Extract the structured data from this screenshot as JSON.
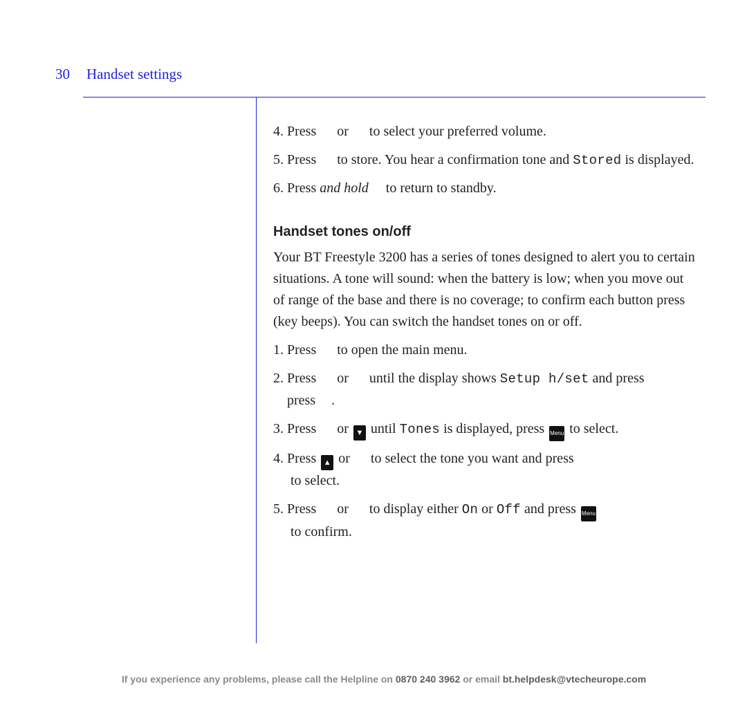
{
  "header": {
    "page_number": "30",
    "section": "Handset settings"
  },
  "steps_top": {
    "s4_a": "4. Press ",
    "s4_or": " or ",
    "s4_b": " to select your preferred volume.",
    "s5_a": "5. Press ",
    "s5_b": " to store. You hear a confirmation tone and ",
    "s5_stored": "Stored",
    "s5_c": " is displayed.",
    "s6_a": "6. Press ",
    "s6_hold": "and hold",
    "s6_b": "  to return to standby."
  },
  "subheading": "Handset tones on/off",
  "intro": "Your BT Freestyle 3200 has a series of tones designed to alert you to certain situations. A tone will sound: when the battery is low; when you move out of range of the base and there is no coverage; to confirm each button press (key beeps). You can switch the handset tones on or off.",
  "steps_bottom": {
    "s1_a": "1. Press ",
    "s1_b": " to open the main menu.",
    "s2_a": "2. Press ",
    "s2_or": " or ",
    "s2_b": " until the display shows ",
    "s2_setup": "Setup h/set",
    "s2_c": " and press ",
    "s2_d": " .",
    "s3_a": "3. Press ",
    "s3_or": " or ",
    "s3_b": " until ",
    "s3_tones": "Tones",
    "s3_c": " is displayed, press ",
    "s3_d": " to select.",
    "s4_a": "4. Press ",
    "s4_or": " or ",
    "s4_b": " to select the tone you want and press ",
    "s4_c": " to select.",
    "s5_a": "5. Press ",
    "s5_or": " or ",
    "s5_b": " to display either ",
    "s5_on": "On",
    "s5_or2": " or ",
    "s5_off": "Off",
    "s5_c": " and press ",
    "s5_d": " to confirm."
  },
  "icons": {
    "up": "▲",
    "down": "▼",
    "menu": "Menu"
  },
  "footer": {
    "a": "If you experience any problems, please call the Helpline on ",
    "b": "0870 240 3962",
    "c": " or email ",
    "d": "bt.helpdesk@vtecheurope.com"
  }
}
